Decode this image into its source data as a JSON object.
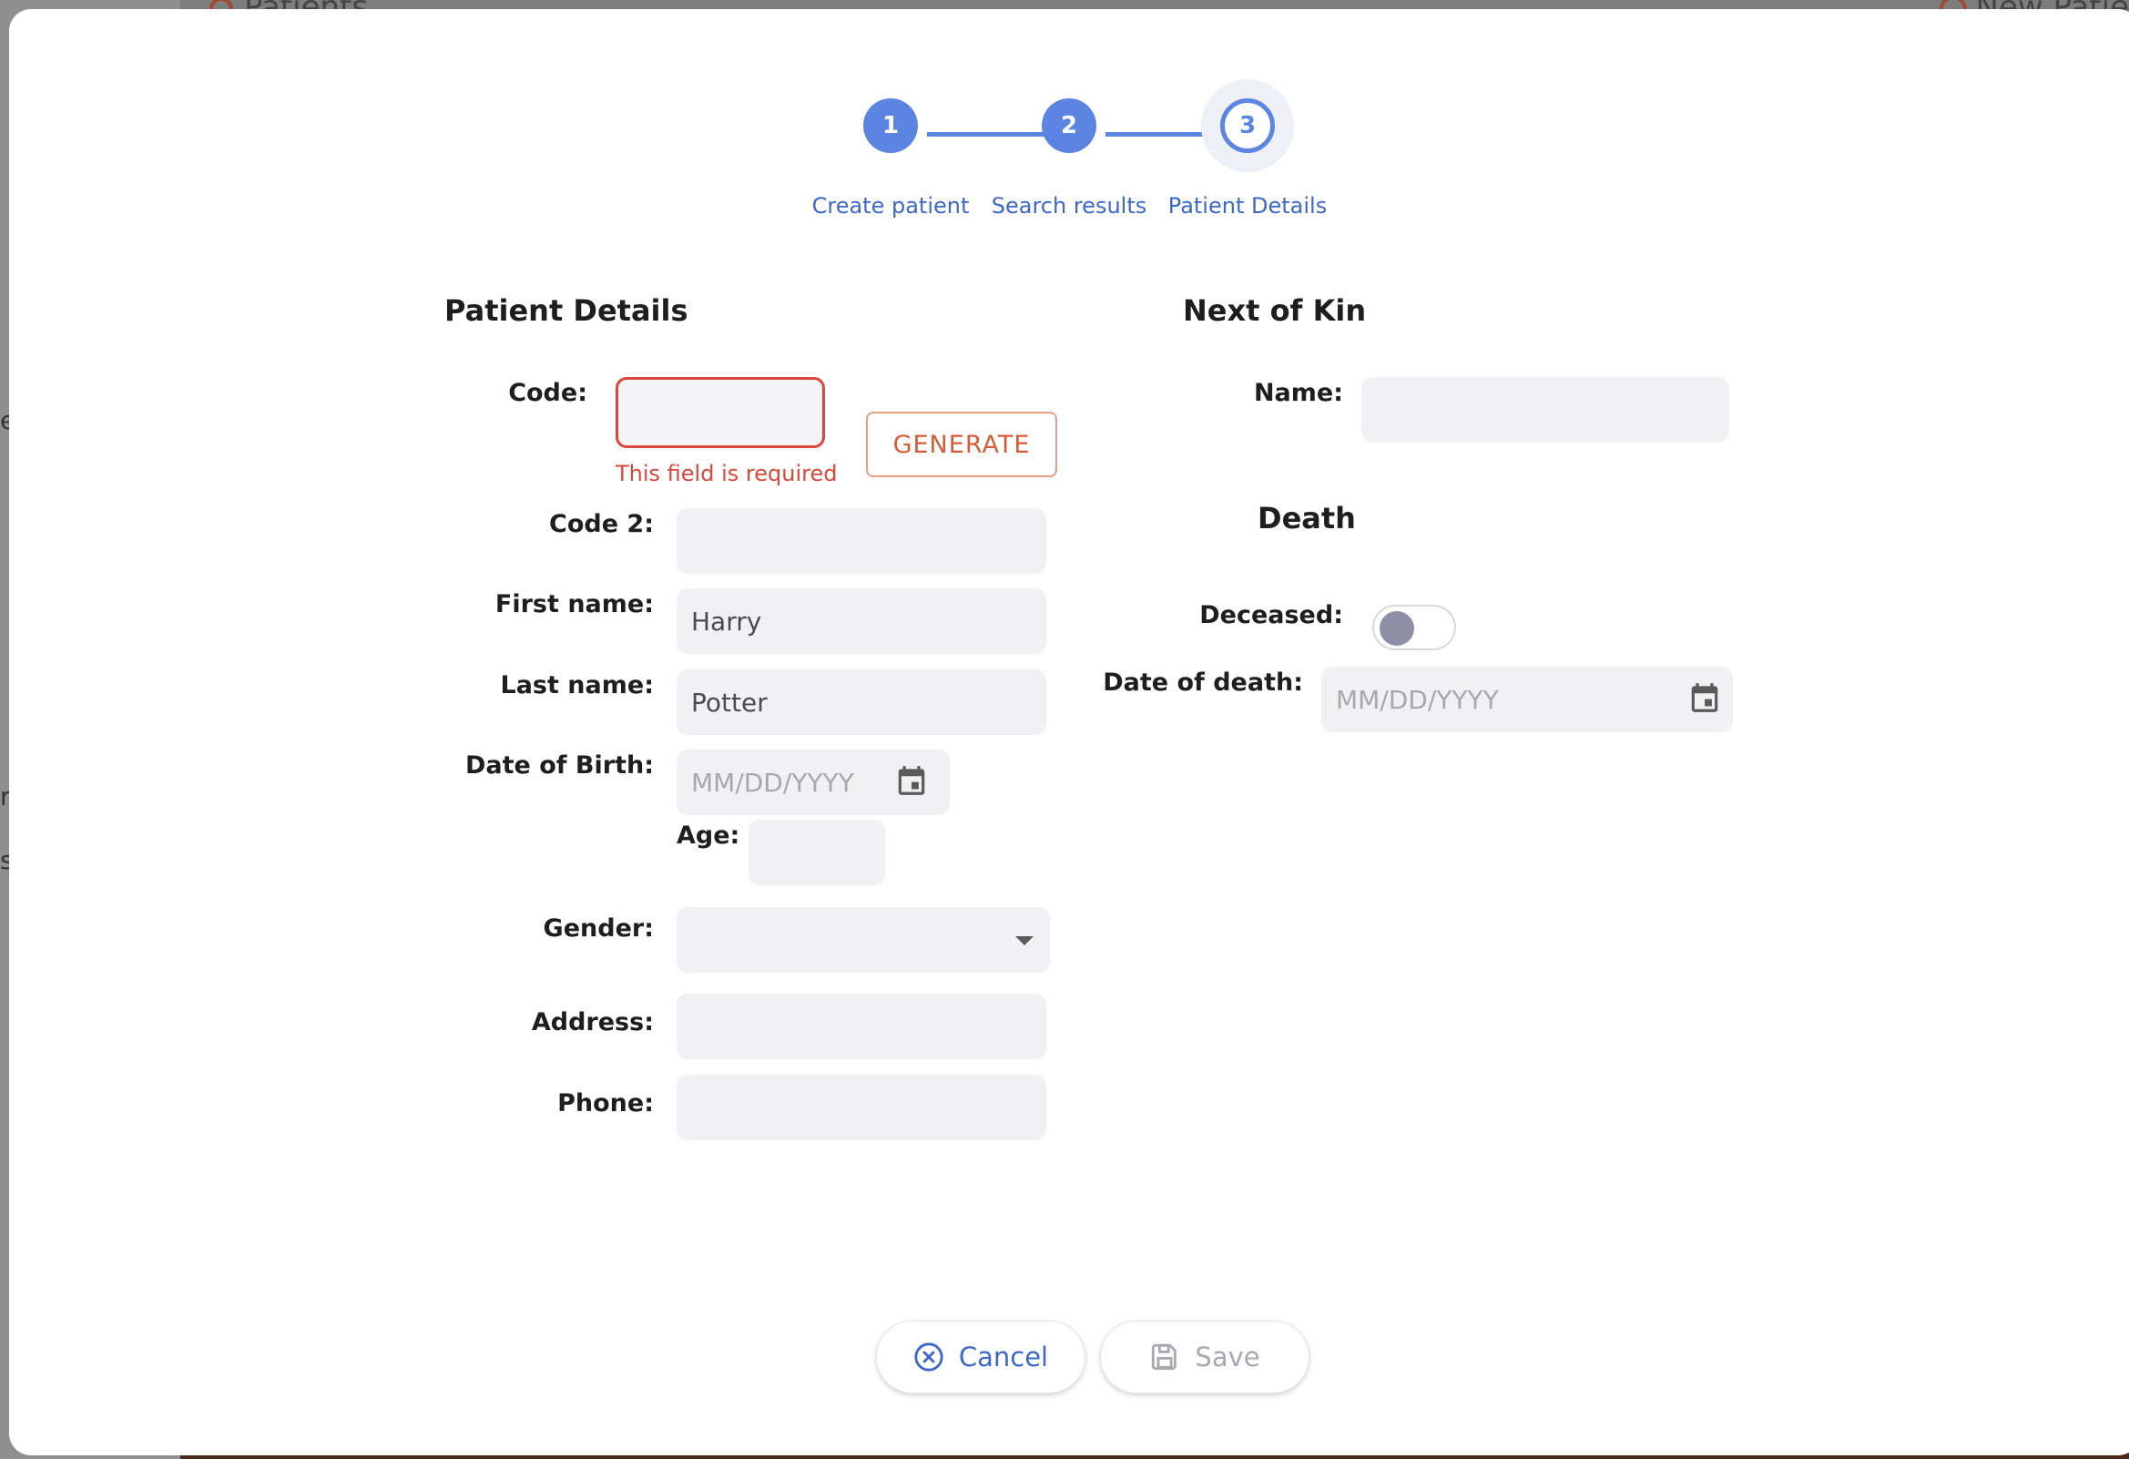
{
  "background": {
    "title": "Patients",
    "new_button": "New Patie",
    "edge_letters": [
      "e",
      "r",
      "s"
    ]
  },
  "stepper": {
    "steps": [
      {
        "number": "1",
        "label": "Create patient",
        "state": "done"
      },
      {
        "number": "2",
        "label": "Search results",
        "state": "done"
      },
      {
        "number": "3",
        "label": "Patient Details",
        "state": "current"
      }
    ]
  },
  "patient": {
    "title": "Patient Details",
    "code_label": "Code:",
    "code_value": "",
    "code_error": "This field is required",
    "generate_label": "GENERATE",
    "code2_label": "Code 2:",
    "code2_value": "",
    "first_name_label": "First name:",
    "first_name_value": "Harry",
    "last_name_label": "Last name:",
    "last_name_value": "Potter",
    "dob_label": "Date of Birth:",
    "dob_placeholder": "MM/DD/YYYY",
    "age_label": "Age:",
    "age_value": "",
    "gender_label": "Gender:",
    "gender_value": "",
    "address_label": "Address:",
    "address_value": "",
    "phone_label": "Phone:",
    "phone_value": ""
  },
  "next_of_kin": {
    "title": "Next of Kin",
    "name_label": "Name:",
    "name_value": ""
  },
  "death": {
    "title": "Death",
    "deceased_label": "Deceased:",
    "deceased": false,
    "date_label": "Date of death:",
    "date_placeholder": "MM/DD/YYYY"
  },
  "footer": {
    "cancel_label": "Cancel",
    "save_label": "Save"
  },
  "colors": {
    "accent": "#5b85e0",
    "error": "#d9473d",
    "generate": "#d65b38"
  }
}
